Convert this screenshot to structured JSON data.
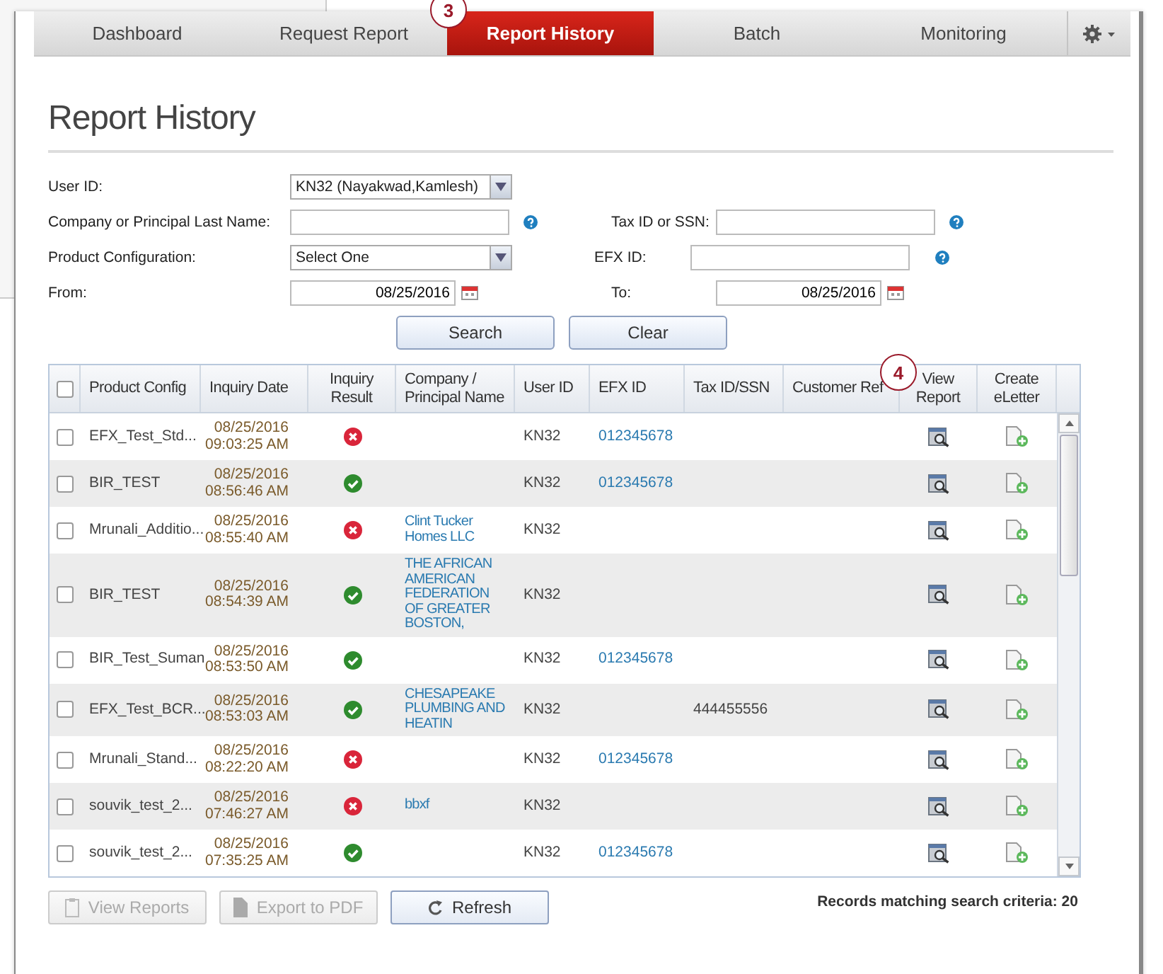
{
  "tabs": [
    {
      "label": "Dashboard",
      "selected": false
    },
    {
      "label": "Request Report",
      "selected": false
    },
    {
      "label": "Report History",
      "selected": true
    },
    {
      "label": "Batch",
      "selected": false
    },
    {
      "label": "Monitoring",
      "selected": false
    }
  ],
  "callouts": [
    "3",
    "4"
  ],
  "page_title": "Report History",
  "form": {
    "user_id": {
      "label": "User ID:",
      "value": "KN32 (Nayakwad,Kamlesh)"
    },
    "company": {
      "label": "Company or Principal Last Name:"
    },
    "tax_id": {
      "label": "Tax ID or SSN:"
    },
    "product_config": {
      "label": "Product Configuration:",
      "value": "Select One"
    },
    "efx_id": {
      "label": "EFX ID:"
    },
    "from": {
      "label": "From:",
      "value": "08/25/2016"
    },
    "to": {
      "label": "To:",
      "value": "08/25/2016"
    },
    "buttons": [
      "Search",
      "Clear"
    ]
  },
  "table": {
    "header_checked": false,
    "columns": [
      "Product Config",
      "Inquiry Date",
      "Inquiry Result",
      "Company / Principal Name",
      "User ID",
      "EFX ID",
      "Tax ID/SSN",
      "Customer Ref",
      "View Report",
      "Create eLetter"
    ],
    "rows": [
      {
        "checked": false,
        "product": "EFX_Test_Std...",
        "date": "08/25/2016",
        "time": "09:03:25 AM",
        "passed": false,
        "company": "",
        "user": "KN32",
        "efx": "012345678",
        "tax": ""
      },
      {
        "checked": false,
        "product": "BIR_TEST",
        "date": "08/25/2016",
        "time": "08:56:46 AM",
        "passed": true,
        "company": "",
        "user": "KN32",
        "efx": "012345678",
        "tax": ""
      },
      {
        "checked": false,
        "product": "Mrunali_Additio...",
        "date": "08/25/2016",
        "time": "08:55:40 AM",
        "passed": false,
        "company": "Clint Tucker Homes LLC",
        "user": "KN32",
        "efx": "",
        "tax": ""
      },
      {
        "checked": false,
        "product": "BIR_TEST",
        "date": "08/25/2016",
        "time": "08:54:39 AM",
        "passed": true,
        "company": "THE AFRICAN AMERICAN FEDERATION OF GREATER BOSTON,",
        "user": "KN32",
        "efx": "",
        "tax": ""
      },
      {
        "checked": false,
        "product": "BIR_Test_Suman",
        "date": "08/25/2016",
        "time": "08:53:50 AM",
        "passed": true,
        "company": "",
        "user": "KN32",
        "efx": "012345678",
        "tax": ""
      },
      {
        "checked": false,
        "product": "EFX_Test_BCR...",
        "date": "08/25/2016",
        "time": "08:53:03 AM",
        "passed": true,
        "company": "CHESAPEAKE PLUMBING AND HEATIN",
        "user": "KN32",
        "efx": "",
        "tax": "444455556"
      },
      {
        "checked": false,
        "product": "Mrunali_Stand...",
        "date": "08/25/2016",
        "time": "08:22:20 AM",
        "passed": false,
        "company": "",
        "user": "KN32",
        "efx": "012345678",
        "tax": ""
      },
      {
        "checked": false,
        "product": "souvik_test_2...",
        "date": "08/25/2016",
        "time": "07:46:27 AM",
        "passed": false,
        "company": "bbxf",
        "user": "KN32",
        "efx": "",
        "tax": ""
      },
      {
        "checked": false,
        "product": "souvik_test_2...",
        "date": "08/25/2016",
        "time": "07:35:25 AM",
        "passed": true,
        "company": "",
        "user": "KN32",
        "efx": "012345678",
        "tax": ""
      }
    ]
  },
  "actions": [
    {
      "label": "View Reports",
      "kind": "clipboard",
      "disabled": true
    },
    {
      "label": "Export to PDF",
      "kind": "pdf",
      "disabled": true
    },
    {
      "label": "Refresh",
      "kind": "refresh",
      "disabled": false
    }
  ],
  "records_text": "Records matching search criteria: 20"
}
